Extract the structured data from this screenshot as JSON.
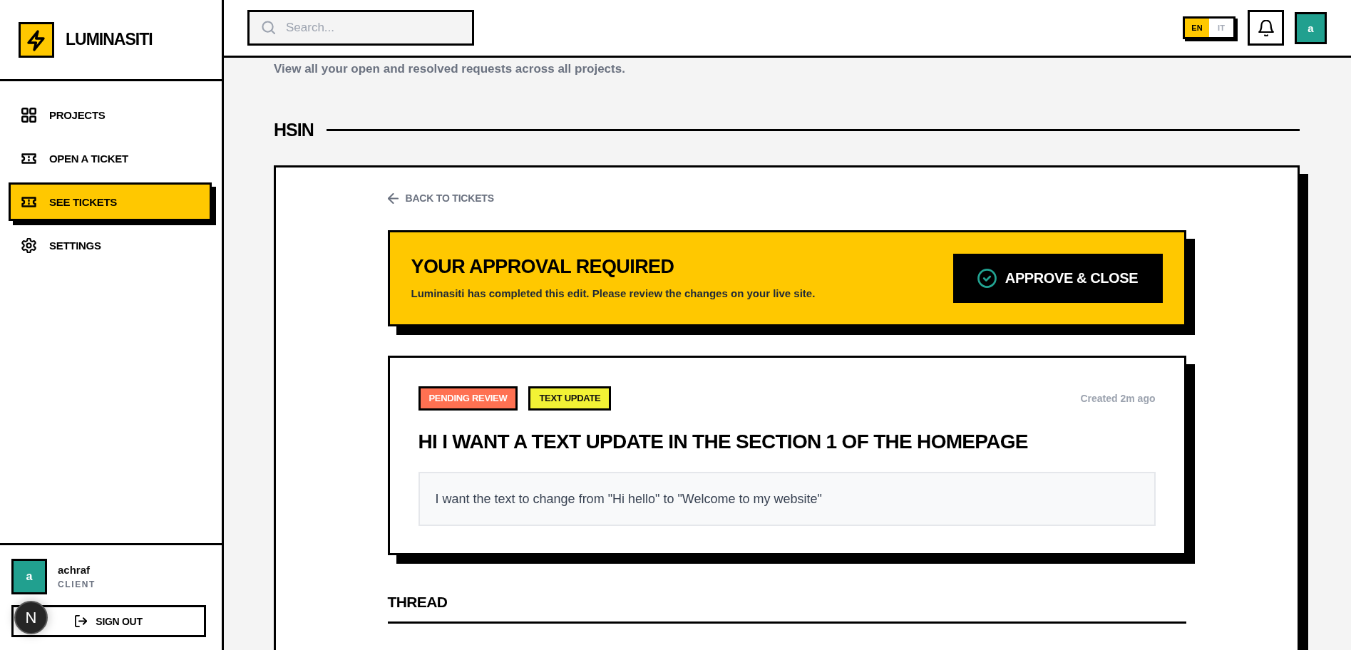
{
  "brand": {
    "name": "LUMINASITI"
  },
  "sidebar": {
    "items": [
      {
        "label": "PROJECTS",
        "selected": false
      },
      {
        "label": "OPEN A TICKET",
        "selected": false
      },
      {
        "label": "SEE TICKETS",
        "selected": true
      },
      {
        "label": "SETTINGS",
        "selected": false
      }
    ]
  },
  "user": {
    "initial": "a",
    "name": "achraf",
    "role": "CLIENT"
  },
  "sign_out": {
    "label": "SIGN OUT"
  },
  "dev_indicator": {
    "label": "N"
  },
  "topbar": {
    "search": {
      "placeholder": "Search..."
    },
    "languages": [
      {
        "label": "EN",
        "selected": true
      },
      {
        "label": "IT",
        "selected": false
      }
    ],
    "avatar": {
      "initial": "a"
    }
  },
  "page": {
    "subtitle": "View all your open and resolved requests across all projects.",
    "project": "HSIN"
  },
  "ticket": {
    "back_link": "BACK TO TICKETS",
    "approval": {
      "title": "YOUR APPROVAL REQUIRED",
      "message": "Luminasiti has completed this edit. Please review the changes on your live site.",
      "button": "APPROVE & CLOSE"
    },
    "tags": [
      {
        "label": "PENDING REVIEW",
        "color": "#ff7152"
      },
      {
        "label": "TEXT UPDATE",
        "color": "#f2f235"
      }
    ],
    "created": "Created 2m ago",
    "title": "HI I WANT A TEXT UPDATE IN THE SECTION 1 OF THE HOMEPAGE",
    "description": "I want the text to change from \"Hi hello\" to \"Welcome to my website\"",
    "thread_heading": "THREAD"
  }
}
